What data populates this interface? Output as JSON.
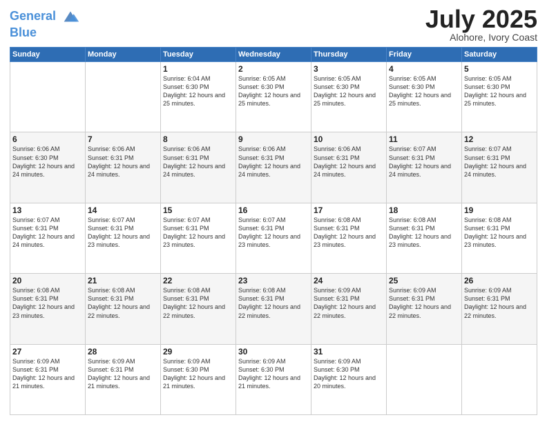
{
  "header": {
    "logo_line1": "General",
    "logo_line2": "Blue",
    "month_year": "July 2025",
    "location": "Alohore, Ivory Coast"
  },
  "days_of_week": [
    "Sunday",
    "Monday",
    "Tuesday",
    "Wednesday",
    "Thursday",
    "Friday",
    "Saturday"
  ],
  "weeks": [
    [
      {
        "day": "",
        "info": ""
      },
      {
        "day": "",
        "info": ""
      },
      {
        "day": "1",
        "info": "Sunrise: 6:04 AM\nSunset: 6:30 PM\nDaylight: 12 hours and 25 minutes."
      },
      {
        "day": "2",
        "info": "Sunrise: 6:05 AM\nSunset: 6:30 PM\nDaylight: 12 hours and 25 minutes."
      },
      {
        "day": "3",
        "info": "Sunrise: 6:05 AM\nSunset: 6:30 PM\nDaylight: 12 hours and 25 minutes."
      },
      {
        "day": "4",
        "info": "Sunrise: 6:05 AM\nSunset: 6:30 PM\nDaylight: 12 hours and 25 minutes."
      },
      {
        "day": "5",
        "info": "Sunrise: 6:05 AM\nSunset: 6:30 PM\nDaylight: 12 hours and 25 minutes."
      }
    ],
    [
      {
        "day": "6",
        "info": "Sunrise: 6:06 AM\nSunset: 6:30 PM\nDaylight: 12 hours and 24 minutes."
      },
      {
        "day": "7",
        "info": "Sunrise: 6:06 AM\nSunset: 6:31 PM\nDaylight: 12 hours and 24 minutes."
      },
      {
        "day": "8",
        "info": "Sunrise: 6:06 AM\nSunset: 6:31 PM\nDaylight: 12 hours and 24 minutes."
      },
      {
        "day": "9",
        "info": "Sunrise: 6:06 AM\nSunset: 6:31 PM\nDaylight: 12 hours and 24 minutes."
      },
      {
        "day": "10",
        "info": "Sunrise: 6:06 AM\nSunset: 6:31 PM\nDaylight: 12 hours and 24 minutes."
      },
      {
        "day": "11",
        "info": "Sunrise: 6:07 AM\nSunset: 6:31 PM\nDaylight: 12 hours and 24 minutes."
      },
      {
        "day": "12",
        "info": "Sunrise: 6:07 AM\nSunset: 6:31 PM\nDaylight: 12 hours and 24 minutes."
      }
    ],
    [
      {
        "day": "13",
        "info": "Sunrise: 6:07 AM\nSunset: 6:31 PM\nDaylight: 12 hours and 24 minutes."
      },
      {
        "day": "14",
        "info": "Sunrise: 6:07 AM\nSunset: 6:31 PM\nDaylight: 12 hours and 23 minutes."
      },
      {
        "day": "15",
        "info": "Sunrise: 6:07 AM\nSunset: 6:31 PM\nDaylight: 12 hours and 23 minutes."
      },
      {
        "day": "16",
        "info": "Sunrise: 6:07 AM\nSunset: 6:31 PM\nDaylight: 12 hours and 23 minutes."
      },
      {
        "day": "17",
        "info": "Sunrise: 6:08 AM\nSunset: 6:31 PM\nDaylight: 12 hours and 23 minutes."
      },
      {
        "day": "18",
        "info": "Sunrise: 6:08 AM\nSunset: 6:31 PM\nDaylight: 12 hours and 23 minutes."
      },
      {
        "day": "19",
        "info": "Sunrise: 6:08 AM\nSunset: 6:31 PM\nDaylight: 12 hours and 23 minutes."
      }
    ],
    [
      {
        "day": "20",
        "info": "Sunrise: 6:08 AM\nSunset: 6:31 PM\nDaylight: 12 hours and 23 minutes."
      },
      {
        "day": "21",
        "info": "Sunrise: 6:08 AM\nSunset: 6:31 PM\nDaylight: 12 hours and 22 minutes."
      },
      {
        "day": "22",
        "info": "Sunrise: 6:08 AM\nSunset: 6:31 PM\nDaylight: 12 hours and 22 minutes."
      },
      {
        "day": "23",
        "info": "Sunrise: 6:08 AM\nSunset: 6:31 PM\nDaylight: 12 hours and 22 minutes."
      },
      {
        "day": "24",
        "info": "Sunrise: 6:09 AM\nSunset: 6:31 PM\nDaylight: 12 hours and 22 minutes."
      },
      {
        "day": "25",
        "info": "Sunrise: 6:09 AM\nSunset: 6:31 PM\nDaylight: 12 hours and 22 minutes."
      },
      {
        "day": "26",
        "info": "Sunrise: 6:09 AM\nSunset: 6:31 PM\nDaylight: 12 hours and 22 minutes."
      }
    ],
    [
      {
        "day": "27",
        "info": "Sunrise: 6:09 AM\nSunset: 6:31 PM\nDaylight: 12 hours and 21 minutes."
      },
      {
        "day": "28",
        "info": "Sunrise: 6:09 AM\nSunset: 6:31 PM\nDaylight: 12 hours and 21 minutes."
      },
      {
        "day": "29",
        "info": "Sunrise: 6:09 AM\nSunset: 6:30 PM\nDaylight: 12 hours and 21 minutes."
      },
      {
        "day": "30",
        "info": "Sunrise: 6:09 AM\nSunset: 6:30 PM\nDaylight: 12 hours and 21 minutes."
      },
      {
        "day": "31",
        "info": "Sunrise: 6:09 AM\nSunset: 6:30 PM\nDaylight: 12 hours and 20 minutes."
      },
      {
        "day": "",
        "info": ""
      },
      {
        "day": "",
        "info": ""
      }
    ]
  ]
}
